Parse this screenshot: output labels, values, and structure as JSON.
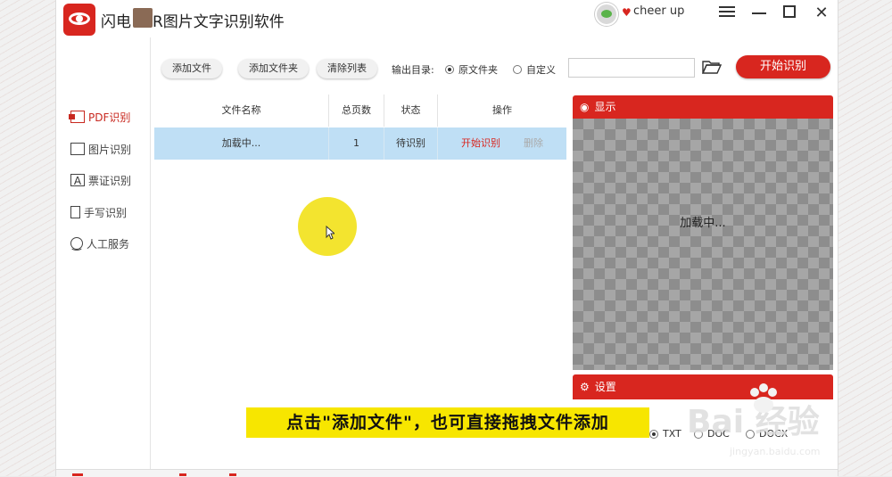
{
  "app": {
    "title_prefix": "闪电",
    "title_suffix": "R图片文字识别软件",
    "username": "cheer up"
  },
  "sidebar": {
    "items": [
      {
        "label": "PDF识别",
        "icon": "pdf-icon",
        "active": true
      },
      {
        "label": "图片识别",
        "icon": "image-icon"
      },
      {
        "label": "票证识别",
        "icon": "ticket-icon"
      },
      {
        "label": "手写识别",
        "icon": "handwriting-icon"
      },
      {
        "label": "人工服务",
        "icon": "smile-icon"
      }
    ]
  },
  "toolbar": {
    "add_file": "添加文件",
    "add_folder": "添加文件夹",
    "clear_list": "清除列表",
    "output_label": "输出目录:",
    "opt_original": "原文件夹",
    "opt_custom": "自定义",
    "path_value": "",
    "start": "开始识别"
  },
  "table": {
    "headers": [
      "文件名称",
      "总页数",
      "状态",
      "操作"
    ],
    "rows": [
      {
        "name": "加载中...",
        "pages": "1",
        "status": "待识别",
        "op_start": "开始识别",
        "op_delete": "删除"
      }
    ]
  },
  "preview": {
    "title": "显示",
    "loading": "加载中..."
  },
  "settings": {
    "title": "设置",
    "formats": [
      "TXT",
      "DOC",
      "DOCX"
    ],
    "selected": "TXT"
  },
  "caption": "点击\"添加文件\"，也可直接拖拽文件添加",
  "watermark": {
    "main": "Bai 经验",
    "sub": "jingyan.baidu.com"
  },
  "colors": {
    "accent": "#d8261f",
    "row_selected": "#bfdff5",
    "caption_bg": "#f7e600"
  }
}
